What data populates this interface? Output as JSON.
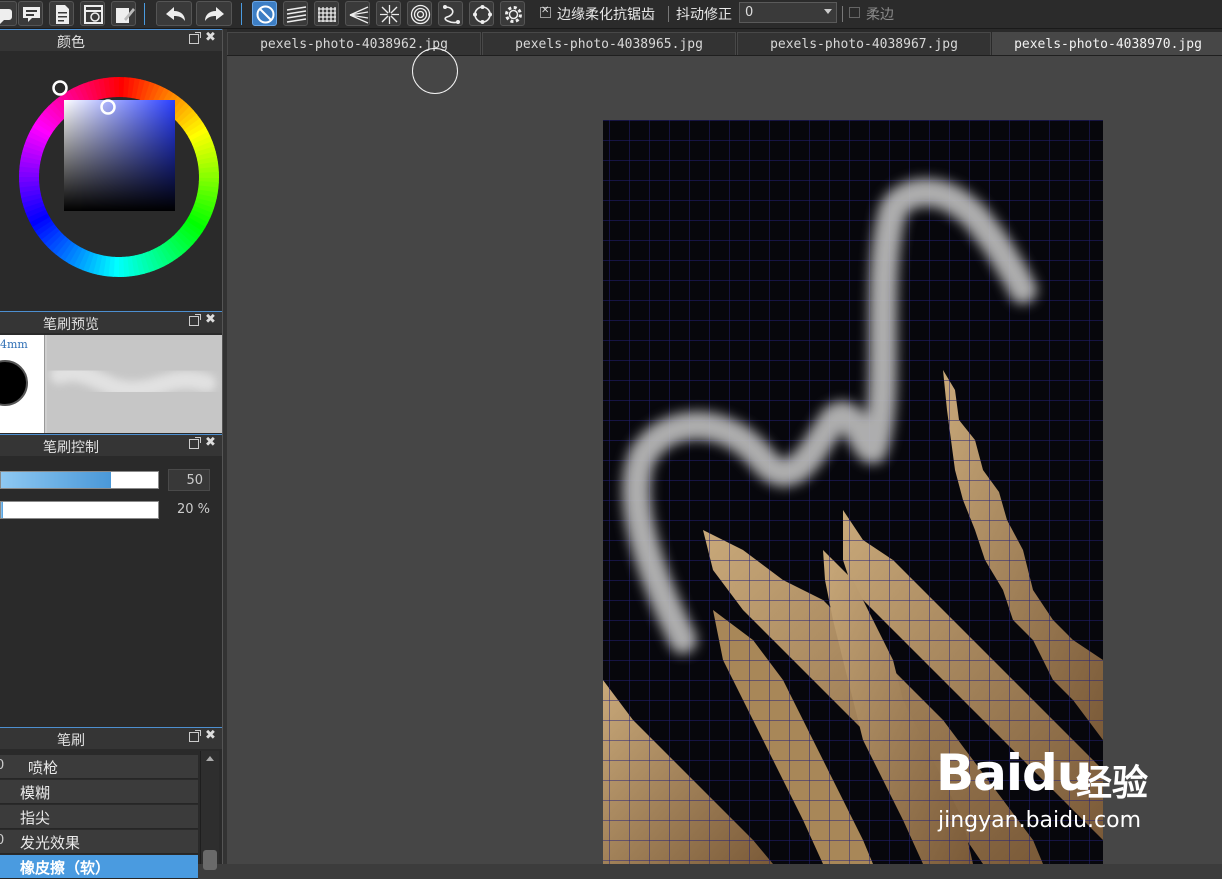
{
  "toolbar": {
    "antialias_label": "边缘柔化抗锯齿",
    "stabilizer_label": "抖动修正",
    "stabilizer_value": "0",
    "soft_edge_label": "柔边"
  },
  "panels": {
    "color": {
      "title": "颜色"
    },
    "brush_preview": {
      "title": "笔刷预览",
      "size_label": "4mm"
    },
    "brush_control": {
      "title": "笔刷控制",
      "size_value": "50",
      "opacity_value": "20 %",
      "size_fill": 0.7,
      "opacity_fill": 0.01
    },
    "brush": {
      "title": "笔刷",
      "items": [
        {
          "label": "喷枪",
          "icon": "0"
        },
        {
          "label": "模糊",
          "icon": ""
        },
        {
          "label": "指尖",
          "icon": ""
        },
        {
          "label": "发光效果",
          "icon": "0"
        },
        {
          "label": "橡皮擦（软）",
          "icon": ""
        }
      ]
    }
  },
  "document_tabs": [
    {
      "label": "pexels-photo-4038962.jpg"
    },
    {
      "label": "pexels-photo-4038965.jpg"
    },
    {
      "label": "pexels-photo-4038967.jpg"
    },
    {
      "label": "pexels-photo-4038970.jpg"
    }
  ],
  "watermark": {
    "logo": "Baidu",
    "cn": "经验",
    "url": "jingyan.baidu.com"
  },
  "colors": {
    "accent": "#4a9be0",
    "selected_hue": "#2a3fff"
  }
}
